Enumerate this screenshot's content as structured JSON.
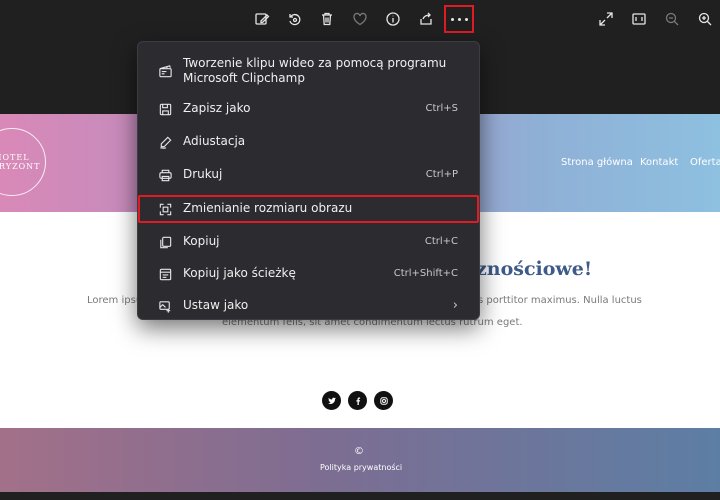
{
  "toolbar": {
    "left_icons": [
      "edit-image-icon",
      "rotate-icon",
      "delete-icon",
      "favorite-icon",
      "info-icon",
      "share-icon"
    ],
    "more_icon": "more-icon",
    "right_icons": [
      "fullscreen-icon",
      "fit-window-icon",
      "zoom-out-icon",
      "zoom-in-icon"
    ]
  },
  "webpage": {
    "logo_line1": "HOTEL",
    "logo_line2": "HORYZONT",
    "nav": [
      "Strona główna",
      "Kontakt",
      "Oferta"
    ],
    "headline": "znościowe!",
    "para_line1_left": "Lorem ipsu",
    "para_line1_right": "s porttitor maximus. Nulla luctus",
    "para_line2": "elementum felis, sit amet condimentum lectus rutrum eget.",
    "footer_copy": "©",
    "footer_link": "Polityka prywatności"
  },
  "menu": {
    "items": [
      {
        "label": "Tworzenie klipu wideo za pomocą programu Microsoft Clipchamp",
        "shortcut": "",
        "icon": "clipchamp-icon"
      },
      {
        "label": "Zapisz jako",
        "shortcut": "Ctrl+S",
        "icon": "save-icon"
      },
      {
        "label": "Adiustacja",
        "shortcut": "",
        "icon": "markup-icon"
      },
      {
        "label": "Drukuj",
        "shortcut": "Ctrl+P",
        "icon": "print-icon"
      },
      {
        "label": "Zmienianie rozmiaru obrazu",
        "shortcut": "",
        "icon": "resize-icon"
      },
      {
        "label": "Kopiuj",
        "shortcut": "Ctrl+C",
        "icon": "copy-icon"
      },
      {
        "label": "Kopiuj jako ścieżkę",
        "shortcut": "Ctrl+Shift+C",
        "icon": "copy-path-icon"
      },
      {
        "label": "Ustaw jako",
        "shortcut": "",
        "icon": "set-as-icon"
      }
    ]
  },
  "colors": {
    "highlight": "#e01b24",
    "menu_bg": "#2b2b30",
    "headline": "#3d5a8a"
  }
}
